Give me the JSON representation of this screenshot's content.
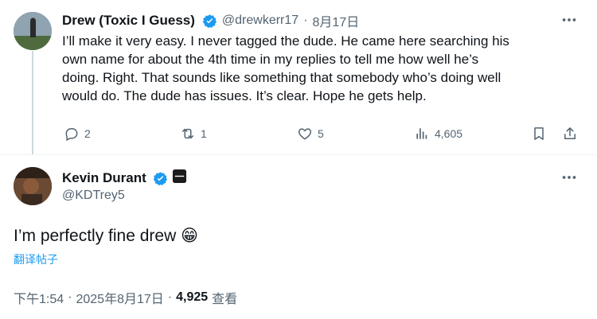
{
  "reply_tweet": {
    "author_name": "Drew (Toxic I Guess)",
    "handle": "@drewkerr17",
    "separator": "·",
    "date": "8月17日",
    "text_lines": [
      "I’ll make it very easy. I never tagged the dude. He came here searching his",
      "own name for about the 4th time in my replies to tell me how well he’s",
      "doing. Right. That sounds like something that somebody who’s doing well",
      "would do. The dude has issues. It’s clear. Hope he gets help."
    ],
    "actions": {
      "replies": "2",
      "reposts": "1",
      "likes": "5",
      "views": "4,605"
    }
  },
  "main_tweet": {
    "author_name": "Kevin Durant",
    "handle": "@KDTrey5",
    "text": "I’m perfectly fine drew 😁",
    "translate_label": "翻译帖子",
    "time": "下午1:54",
    "date": "2025年8月17日",
    "meta_sep": "·",
    "view_count": "4,925",
    "view_label": "查看"
  },
  "colors": {
    "verified_blue": "#1d9bf0",
    "secondary_text": "#536471",
    "primary_text": "#0f1419"
  }
}
